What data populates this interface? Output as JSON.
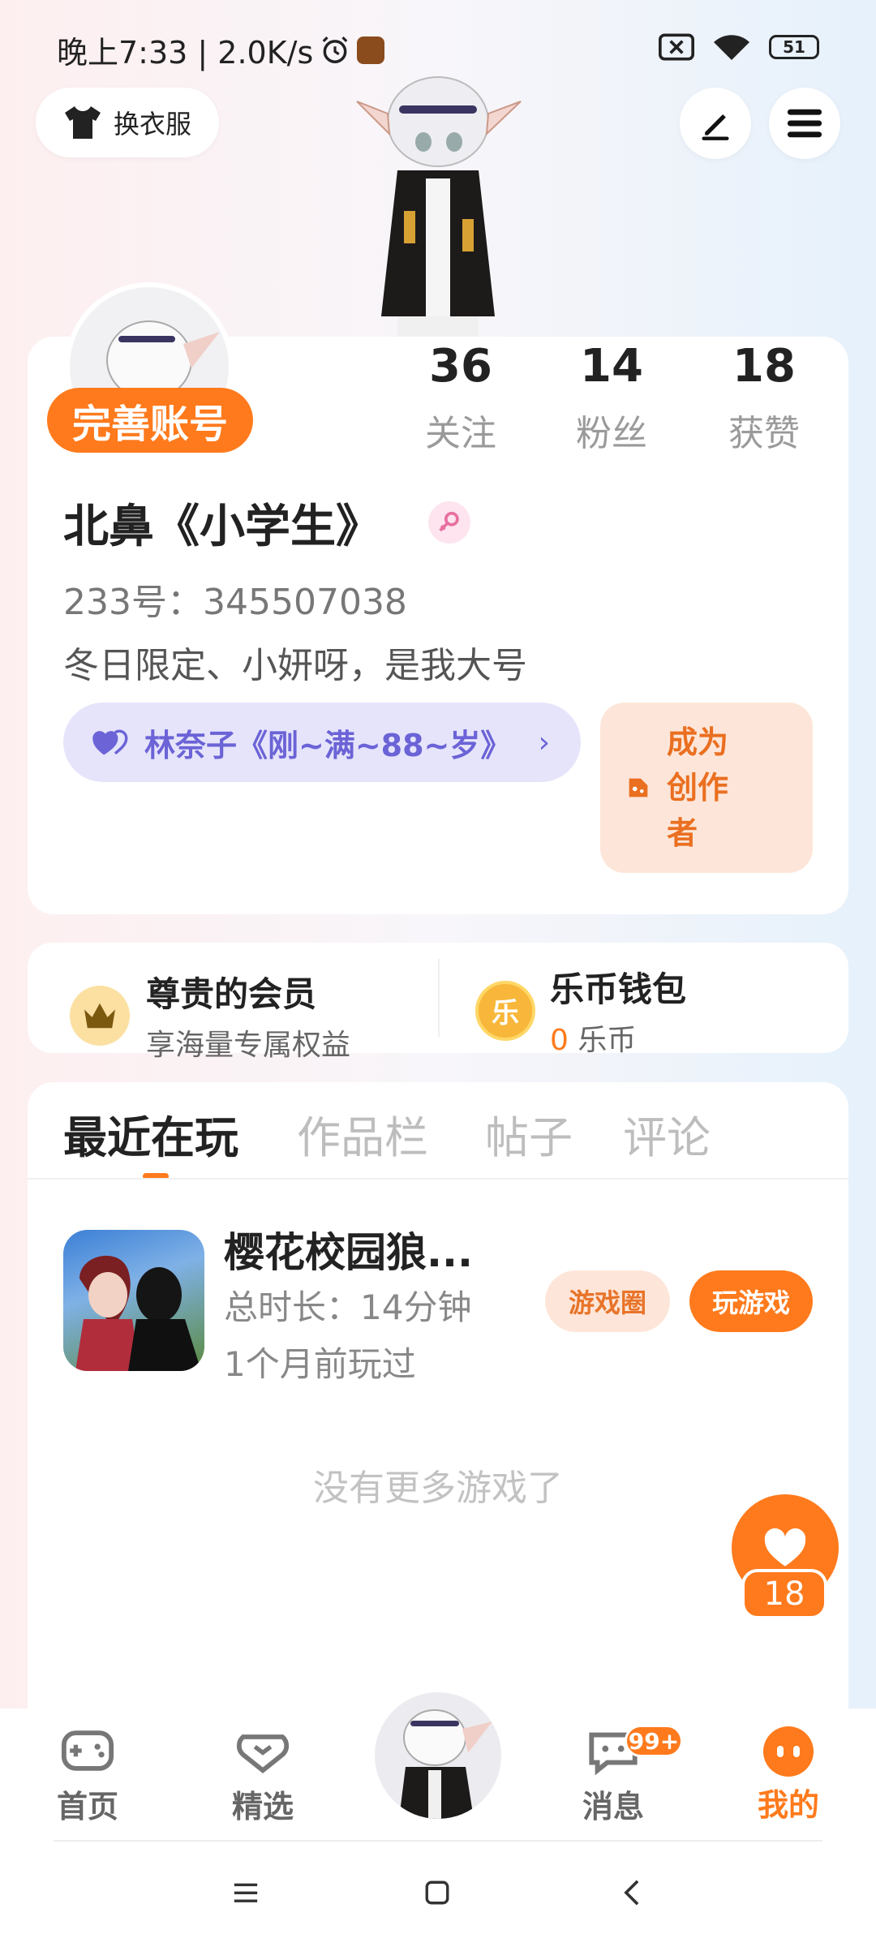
{
  "status_bar": {
    "time_speed": "晚上7:33 | 2.0K/s",
    "battery": "51"
  },
  "header": {
    "wardrobe_label": "换衣服"
  },
  "profile": {
    "complete_label": "完善账号",
    "stats": [
      {
        "value": "36",
        "label": "关注"
      },
      {
        "value": "14",
        "label": "粉丝"
      },
      {
        "value": "18",
        "label": "获赞"
      }
    ],
    "username": "北鼻《小学生》",
    "uid": "233号：345507038",
    "bio": "冬日限定、小妍呀，是我大号",
    "partner": "林奈子《刚~满~88~岁》",
    "partner_chevron": "›",
    "creator_label": "成为创作者"
  },
  "member": {
    "vip_title": "尊贵的会员",
    "vip_sub": "享海量专属权益",
    "wallet_title": "乐币钱包",
    "wallet_amount": "0",
    "wallet_unit": "乐币",
    "wallet_icon_char": "乐"
  },
  "tabs": [
    {
      "label": "最近在玩",
      "active": true
    },
    {
      "label": "作品栏",
      "active": false
    },
    {
      "label": "帖子",
      "active": false
    },
    {
      "label": "评论",
      "active": false
    }
  ],
  "games": [
    {
      "title": "樱花校园狼...",
      "duration": "总时长：14分钟",
      "last_played": "1个月前玩过",
      "circle_label": "游戏圈",
      "play_label": "玩游戏"
    }
  ],
  "no_more": "没有更多游戏了",
  "like_count": "18",
  "bottom_nav": {
    "items": [
      {
        "label": "首页",
        "icon": "gamepad-icon"
      },
      {
        "label": "精选",
        "icon": "heart-chat-icon"
      },
      {
        "label": "消息",
        "icon": "message-icon",
        "badge": "99+"
      },
      {
        "label": "我的",
        "icon": "face-icon",
        "active": true
      }
    ]
  },
  "colors": {
    "accent": "#ff7a1c",
    "partner": "#6b63d6"
  }
}
